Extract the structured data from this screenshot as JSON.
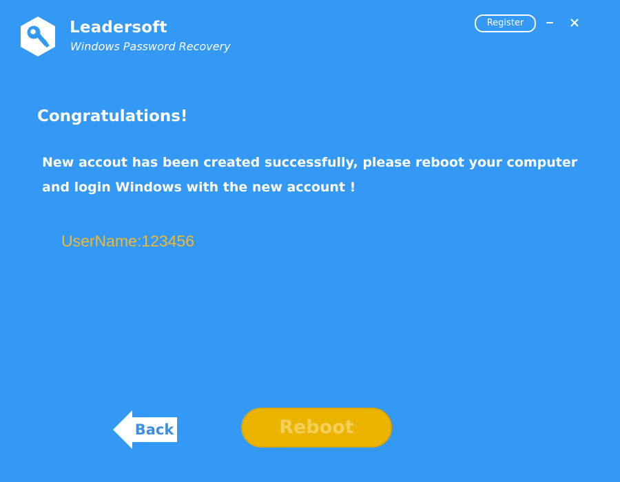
{
  "app": {
    "brand_name": "Leadersoft",
    "product_name": "Windows Password Recovery"
  },
  "titlebar": {
    "register_label": "Register",
    "minimize_icon": "minimize-icon",
    "close_icon": "close-icon"
  },
  "content": {
    "heading": "Congratulations!",
    "message_line1": "New accout has been created successfully, please reboot your computer",
    "message_line2": "and login Windows with the new account !",
    "username": "UserName:123456"
  },
  "footer": {
    "back_label": "Back",
    "reboot_label": "Reboot"
  },
  "colors": {
    "background": "#3399f5",
    "accent_yellow": "#eab400",
    "username_text": "#f2b833",
    "back_text": "#3e8fdf"
  }
}
